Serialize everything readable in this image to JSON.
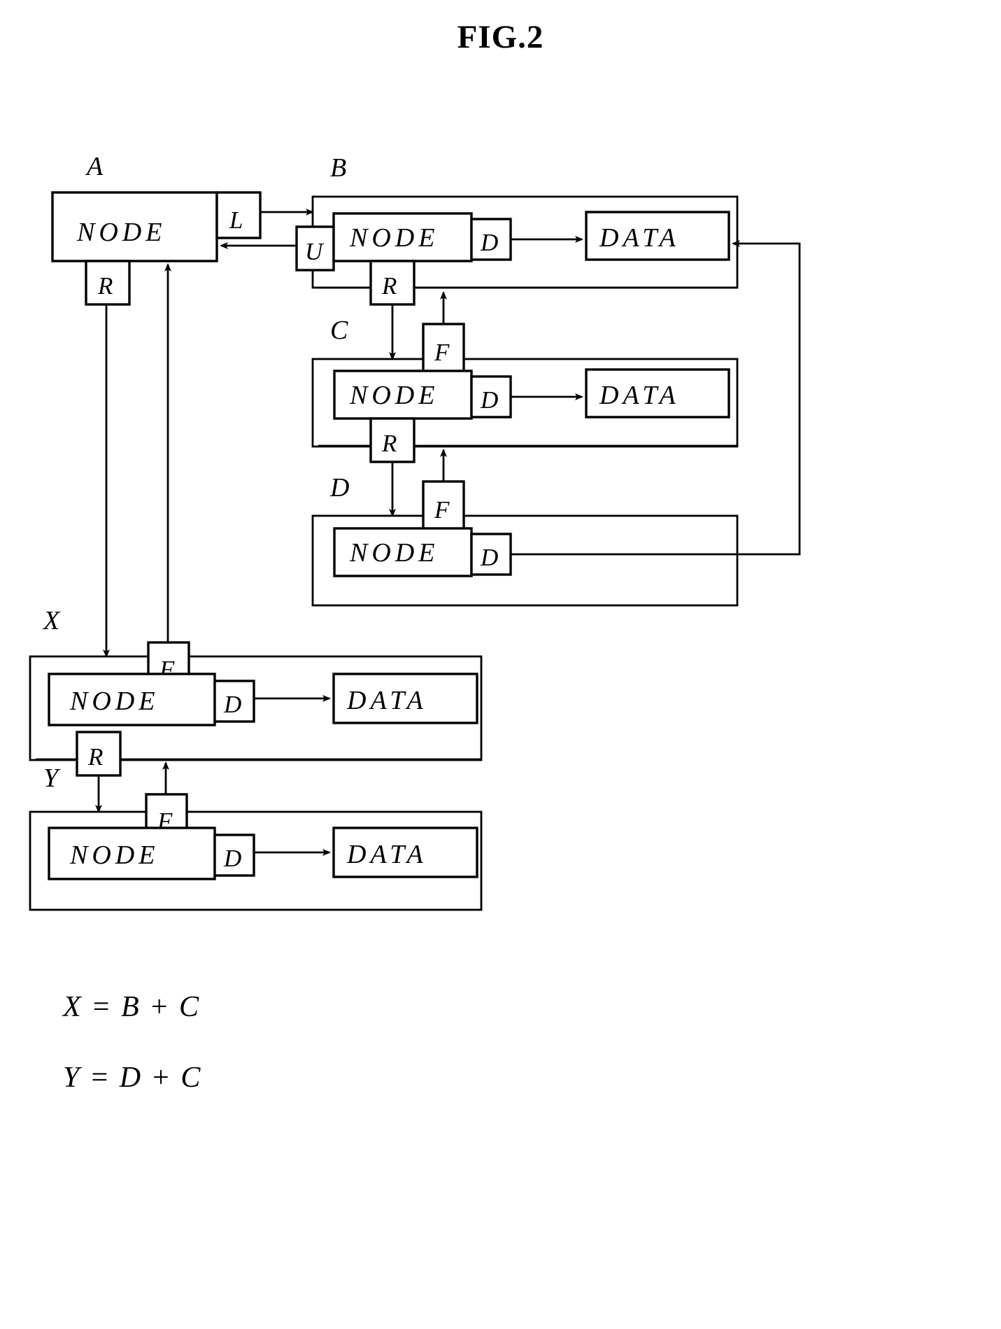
{
  "figure": {
    "title": "FIG.2",
    "type": "patent-block-diagram"
  },
  "labels": {
    "node": "NODE",
    "data": "DATA",
    "port_left": "L",
    "port_up": "U",
    "port_down": "D",
    "port_right": "R",
    "port_father": "F"
  },
  "groups": [
    {
      "id": "A",
      "label": "A",
      "node_label": "NODE",
      "ports": [
        "L",
        "R"
      ],
      "has_data": false
    },
    {
      "id": "B",
      "label": "B",
      "node_label": "NODE",
      "ports": [
        "U",
        "D",
        "R"
      ],
      "has_data": true,
      "data_label": "DATA"
    },
    {
      "id": "C",
      "label": "C",
      "node_label": "NODE",
      "ports": [
        "F",
        "D",
        "R"
      ],
      "has_data": true,
      "data_label": "DATA"
    },
    {
      "id": "D",
      "label": "D",
      "node_label": "NODE",
      "ports": [
        "F",
        "D"
      ],
      "has_data": true,
      "data_label": "DATA"
    },
    {
      "id": "X",
      "label": "X",
      "node_label": "NODE",
      "ports": [
        "F",
        "D",
        "R"
      ],
      "has_data": true,
      "data_label": "DATA"
    },
    {
      "id": "Y",
      "label": "Y",
      "node_label": "NODE",
      "ports": [
        "F",
        "D"
      ],
      "has_data": true,
      "data_label": "DATA"
    }
  ],
  "equations": [
    {
      "id": "eq-x",
      "text": "X =  B + C"
    },
    {
      "id": "eq-y",
      "text": "Y =  D + C"
    }
  ],
  "colors": {
    "ink": "#000000",
    "paper": "#ffffff"
  }
}
